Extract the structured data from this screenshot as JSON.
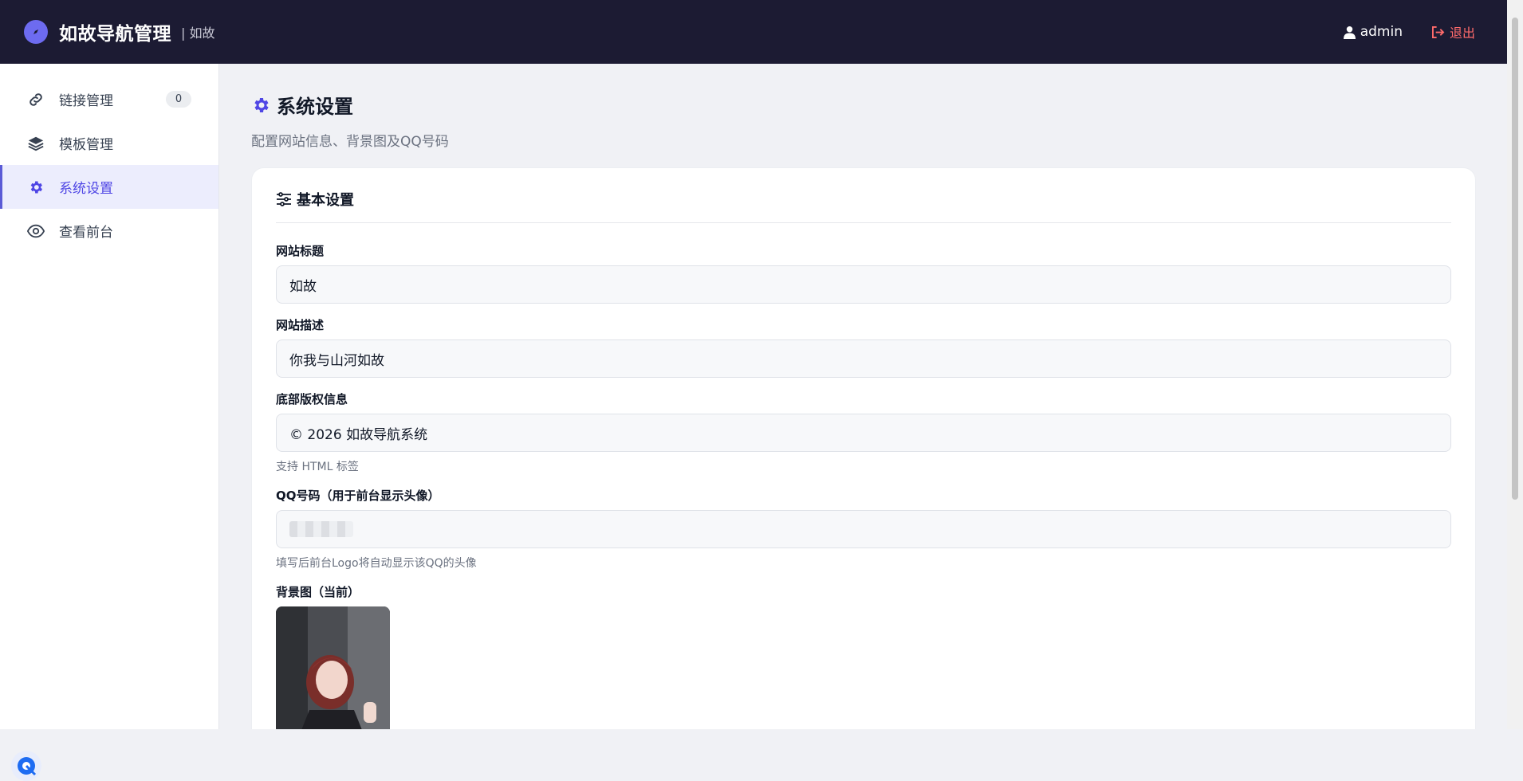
{
  "header": {
    "title": "如故导航管理",
    "subtitle": "| 如故",
    "user": "admin",
    "logout": "退出"
  },
  "sidebar": {
    "items": [
      {
        "label": "链接管理",
        "icon": "link-icon",
        "badge": "0"
      },
      {
        "label": "模板管理",
        "icon": "layers-icon"
      },
      {
        "label": "系统设置",
        "icon": "gear-icon",
        "active": true
      },
      {
        "label": "查看前台",
        "icon": "eye-icon"
      }
    ]
  },
  "page": {
    "title": "系统设置",
    "description": "配置网站信息、背景图及QQ号码"
  },
  "card": {
    "title": "基本设置",
    "fields": {
      "site_title": {
        "label": "网站标题",
        "value": "如故"
      },
      "site_desc": {
        "label": "网站描述",
        "value": "你我与山河如故"
      },
      "copyright": {
        "label": "底部版权信息",
        "value": "© 2026 如故导航系统",
        "hint": "支持 HTML 标签"
      },
      "qq": {
        "label": "QQ号码（用于前台显示头像）",
        "hint": "填写后前台Logo将自动显示该QQ的头像"
      },
      "background": {
        "label": "背景图（当前）"
      }
    }
  },
  "colors": {
    "topbar": "#1c1b33",
    "accent": "#5b5bd6",
    "logout": "#ff6b6b"
  }
}
